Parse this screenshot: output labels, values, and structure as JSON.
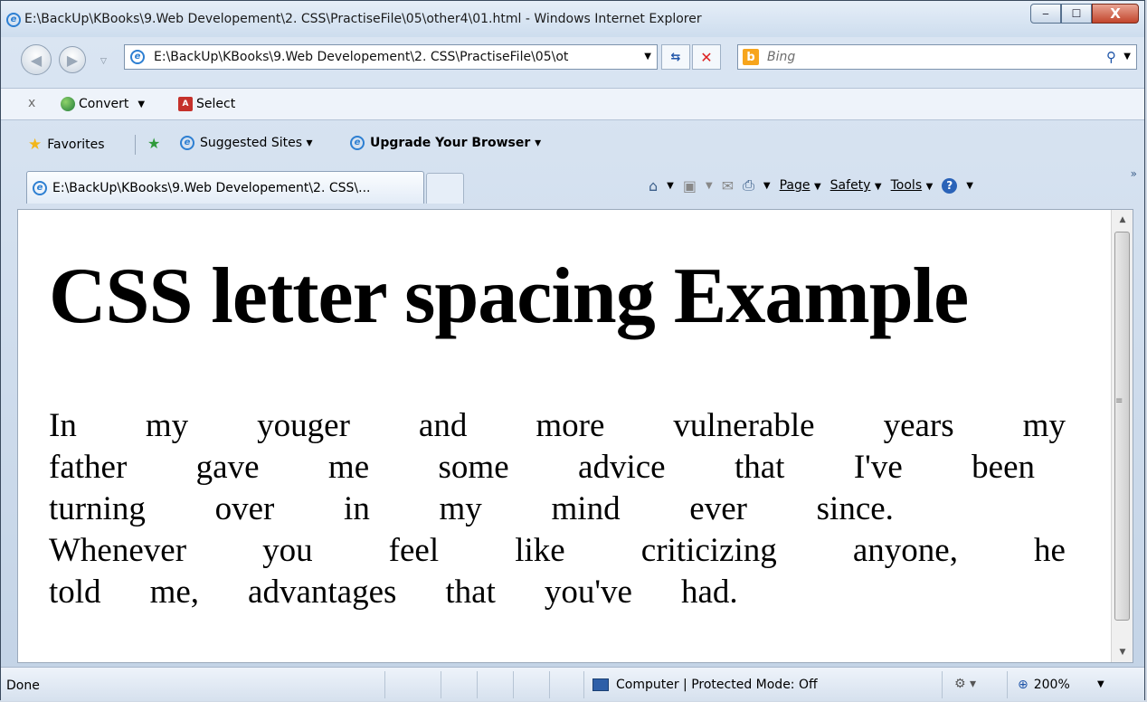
{
  "window": {
    "title": "E:\\BackUp\\KBooks\\9.Web Developement\\2. CSS\\PractiseFile\\05\\other4\\01.html - Windows Internet Explorer",
    "minimize": "‒",
    "maximize": "☐",
    "close": "X"
  },
  "nav": {
    "address": "E:\\BackUp\\KBooks\\9.Web Developement\\2. CSS\\PractiseFile\\05\\ot",
    "search_placeholder": "Bing"
  },
  "toolbar": {
    "close_x": "x",
    "convert_label": "Convert",
    "select_label": "Select"
  },
  "favorites": {
    "favorites_label": "Favorites",
    "suggested_label": "Suggested Sites ▾",
    "upgrade_label": "Upgrade Your Browser ▾"
  },
  "tabs": {
    "active_tab": "E:\\BackUp\\KBooks\\9.Web Developement\\2. CSS\\..."
  },
  "commandbar": {
    "page": "Page",
    "safety": "Safety",
    "tools": "Tools"
  },
  "page": {
    "heading": "CSS letter spacing Example",
    "lines": [
      [
        "In",
        "my",
        "youger",
        "and",
        "more",
        "vulnerable",
        "years",
        "my"
      ],
      [
        "father",
        "gave",
        "me",
        "some",
        "advice",
        "that",
        "I've",
        "been"
      ],
      [
        "turning",
        "over",
        "in",
        "my",
        "mind",
        "ever",
        "since."
      ],
      [
        "Whenever",
        "you",
        "feel",
        "like",
        "criticizing",
        "anyone,",
        "he"
      ],
      [
        "told",
        "me,",
        "advantages",
        "that",
        "you've",
        "had."
      ]
    ]
  },
  "status": {
    "text": "Done",
    "zone": "Computer | Protected Mode: Off",
    "zoom": "200%"
  }
}
